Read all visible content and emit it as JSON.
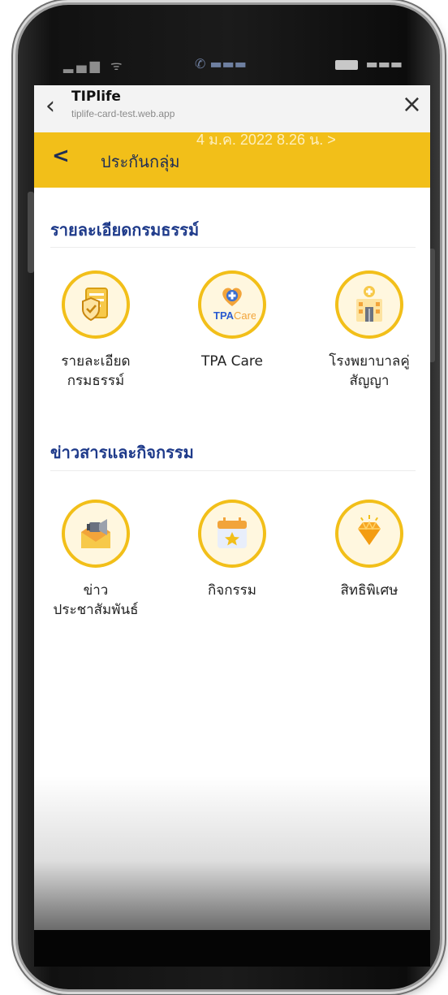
{
  "browser": {
    "title": "TIPlife",
    "url": "tiplife-card-test.web.app",
    "close_glyph": "×",
    "back_glyph": "‹"
  },
  "ghost_notification": "4 ม.ค. 2022 8.26 น.  >",
  "header": {
    "back_glyph": "<",
    "title": "ประกันกลุ่ม"
  },
  "sections": [
    {
      "title": "รายละเอียดกรมธรรม์",
      "tiles": [
        {
          "label": "รายละเอียด\nกรมธรรม์",
          "icon": "policy-document-icon"
        },
        {
          "label": "TPA Care",
          "icon": "tpa-care-icon"
        },
        {
          "label": "โรงพยาบาลคู่\nสัญญา",
          "icon": "hospital-icon"
        }
      ]
    },
    {
      "title": "ข่าวสารและกิจกรรม",
      "tiles": [
        {
          "label": "ข่าว\nประชาสัมพันธ์",
          "icon": "news-megaphone-icon"
        },
        {
          "label": "กิจกรรม",
          "icon": "calendar-star-icon"
        },
        {
          "label": "สิทธิพิเศษ",
          "icon": "diamond-icon"
        }
      ]
    }
  ],
  "colors": {
    "accent": "#f2bf19",
    "heading": "#1e3a8a",
    "header_text": "#1f2e55"
  }
}
